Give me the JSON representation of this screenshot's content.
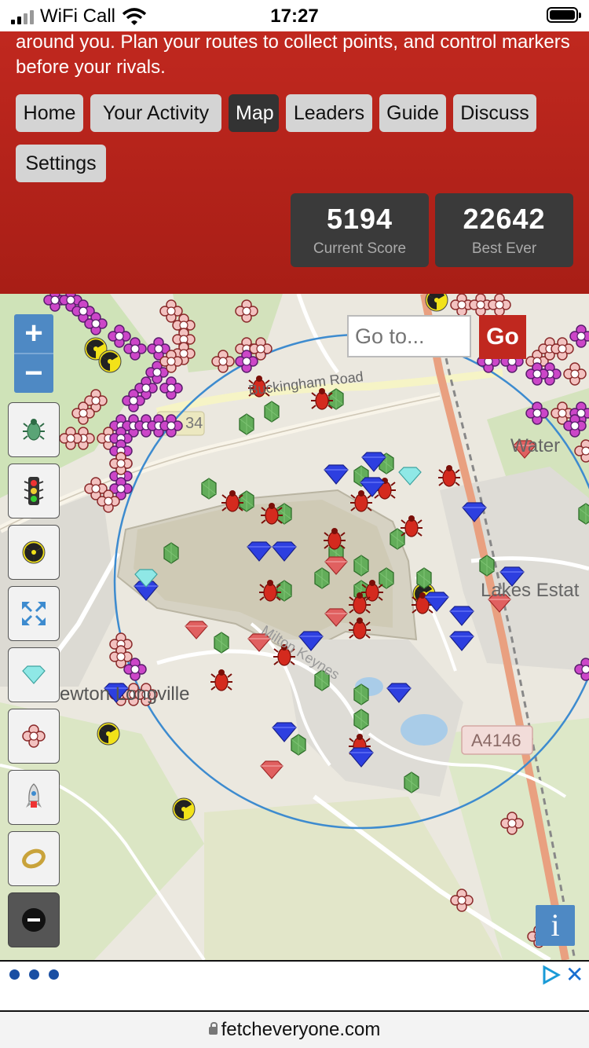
{
  "status_bar": {
    "carrier": "WiFi Call",
    "time": "17:27"
  },
  "header": {
    "intro_text": "around you. Plan your routes to collect points, and control markers before your rivals.",
    "nav": [
      {
        "label": "Home",
        "active": false
      },
      {
        "label": "Your Activity",
        "active": false
      },
      {
        "label": "Map",
        "active": true
      },
      {
        "label": "Leaders",
        "active": false
      },
      {
        "label": "Guide",
        "active": false
      },
      {
        "label": "Discuss",
        "active": false
      },
      {
        "label": "Settings",
        "active": false
      }
    ],
    "scores": [
      {
        "value": "5194",
        "label": "Current Score"
      },
      {
        "value": "22642",
        "label": "Best Ever"
      }
    ]
  },
  "map": {
    "zoom_in": "+",
    "zoom_out": "−",
    "search_placeholder": "Go to...",
    "go_label": "Go",
    "info_label": "i",
    "labels": {
      "road": "Buckingham Road",
      "road_number": "34",
      "area_water": "Water",
      "area_lakes": "Lakes Estat",
      "area_newton": "ewton Longville",
      "area_milton": "Milton Keynes",
      "road_a4146": "A4146"
    },
    "layer_tools": [
      "bug-icon",
      "traffic-light-icon",
      "radiation-icon",
      "fullscreen-icon",
      "diamond-icon",
      "flower-icon",
      "rocket-icon",
      "ring-icon",
      "minus-icon"
    ]
  },
  "ad": {
    "close_label": "✕"
  },
  "url_bar": {
    "domain": "fetcheveryone.com"
  },
  "colors": {
    "header_red": "#b3241b",
    "nav_button": "#d4d4d4",
    "nav_active": "#333333",
    "score_box": "#3a3a3a",
    "leaflet_blue": "#4e89c4",
    "range_circle": "#3d8bcf"
  }
}
